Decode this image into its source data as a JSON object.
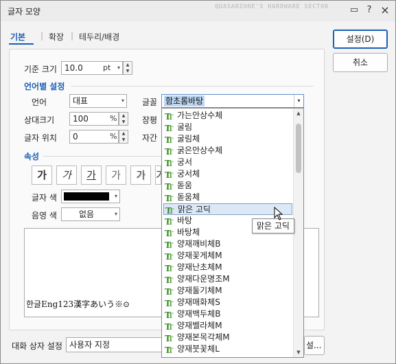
{
  "window": {
    "title": "글자 모양",
    "watermark": "QUASARZONE'S HARDWARE SECTOR",
    "controls": {
      "chat": "▭",
      "help": "?",
      "close": "×"
    }
  },
  "tabs": [
    {
      "label": "기본",
      "active": true
    },
    {
      "label": "확장",
      "active": false
    },
    {
      "label": "테두리/배경",
      "active": false
    }
  ],
  "tab_separator": "|",
  "base_size": {
    "label": "기준 크기",
    "value": "10.0",
    "unit": "pt"
  },
  "lang_section": {
    "title": "언어별 설정",
    "language": {
      "label": "언어",
      "value": "대표"
    },
    "font": {
      "label": "글꼴",
      "value": "함초롬바탕"
    },
    "rel_size": {
      "label": "상대크기",
      "value": "100",
      "unit": "%"
    },
    "position": {
      "label": "글자 위치",
      "value": "0",
      "unit": "%"
    },
    "spacing_label": "장평",
    "gap_label": "자간"
  },
  "attr_section": {
    "title": "속성",
    "format_buttons": [
      "가",
      "가",
      "가",
      "가",
      "가",
      "가"
    ],
    "text_color": {
      "label": "글자 색",
      "value": "#000000"
    },
    "shade_color": {
      "label": "음영 색",
      "value": "없음"
    }
  },
  "preview": {
    "text": "한글Eng123漢字あいう※⊙"
  },
  "bottom": {
    "label": "대화 상자 설정",
    "value": "사용자 지정",
    "extra_button": "설..."
  },
  "buttons": {
    "ok": "설정(D)",
    "cancel": "취소"
  },
  "font_list": [
    "가는안상수체",
    "굴림",
    "굴림체",
    "굵은안상수체",
    "궁서",
    "궁서체",
    "돋움",
    "돋움체",
    "맑은 고딕",
    "바탕",
    "바탕체",
    "양재깨비체B",
    "양재꽃게체M",
    "양재난초체M",
    "양재다운명조M",
    "양재둘기체M",
    "양재매화체S",
    "양재백두체B",
    "양재벨라체M",
    "양재본목각체M",
    "양재붓꽃체L"
  ],
  "hovered_font": "맑은 고딕",
  "tooltip": "맑은 고딕",
  "icons": {
    "truetype": "T",
    "dropdown": "▾",
    "spin_up": "▲",
    "spin_down": "▼",
    "scroll_up": "▲",
    "scroll_down": "▼"
  }
}
